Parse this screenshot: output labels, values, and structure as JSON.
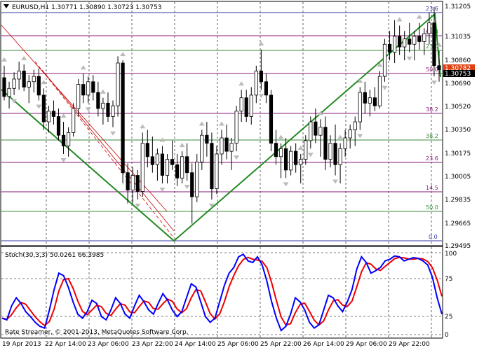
{
  "window": {
    "title": "EURUSD,H1  1.30771 1.30890 1.30723 1.30753",
    "menu_icon": "chart-menu-triangle-icon"
  },
  "indicator": {
    "title": "Stoch(30,3,3) 50.0261 66.3985",
    "levels": [
      "100",
      "75",
      "25",
      "0"
    ]
  },
  "copyright": "Rate Streamer, © 2001-2013, MetaQuotes Software Corp.",
  "colors": {
    "bull": "#000000",
    "bear": "#000000",
    "grid": "#000000",
    "fibo_blue": "#3a3aa8",
    "fibo_purple": "#8a1a7a",
    "fibo_green": "#3b8a3b",
    "trend_green": "#228b22",
    "channel_red": "#cc0000",
    "stoch_main": "#0000ff",
    "stoch_signal": "#ee0000",
    "price_tag_bg": "#e04010",
    "price_tag2_bg": "#000000"
  },
  "price_axis": [
    "1.31205",
    "1.31035",
    "1.30860",
    "1.30690",
    "1.30520",
    "1.30350",
    "1.30175",
    "1.30005",
    "1.29835",
    "1.29665",
    "1.29495"
  ],
  "price_tags": {
    "bid": "1.30753",
    "ask": "1.30782"
  },
  "fibo_labels": [
    "23.6",
    "61.8",
    "23.6",
    "50.0",
    "38.2",
    "38.2",
    "23.6",
    "14.5",
    "50.0",
    "0.0"
  ],
  "time_axis": [
    "19 Apr 2013",
    "22 Apr 14:00",
    "23 Apr 06:00",
    "23 Apr 22:00",
    "24 Apr 14:00",
    "25 Apr 06:00",
    "25 Apr 22:00",
    "26 Apr 14:00",
    "29 Apr 06:00",
    "29 Apr 22:00"
  ],
  "chart_data": {
    "type": "candlestick",
    "symbol": "EURUSD",
    "timeframe": "H1",
    "ylim": [
      1.2945,
      1.3125
    ],
    "candles": [
      [
        1.3069,
        1.3078,
        1.3052,
        1.3055
      ],
      [
        1.3055,
        1.3066,
        1.3046,
        1.3061
      ],
      [
        1.3061,
        1.3073,
        1.3056,
        1.3068
      ],
      [
        1.3068,
        1.3081,
        1.306,
        1.3074
      ],
      [
        1.3074,
        1.3079,
        1.3059,
        1.3062
      ],
      [
        1.3062,
        1.3071,
        1.305,
        1.3066
      ],
      [
        1.3066,
        1.3075,
        1.3058,
        1.307
      ],
      [
        1.307,
        1.3076,
        1.3052,
        1.3056
      ],
      [
        1.3056,
        1.3061,
        1.303,
        1.3036
      ],
      [
        1.3036,
        1.3048,
        1.3028,
        1.3044
      ],
      [
        1.3044,
        1.3052,
        1.3034,
        1.304
      ],
      [
        1.304,
        1.3046,
        1.3022,
        1.3026
      ],
      [
        1.3026,
        1.3036,
        1.3012,
        1.3018
      ],
      [
        1.3018,
        1.3032,
        1.301,
        1.3028
      ],
      [
        1.3028,
        1.305,
        1.3025,
        1.3046
      ],
      [
        1.3046,
        1.3068,
        1.304,
        1.3064
      ],
      [
        1.3064,
        1.3072,
        1.305,
        1.3056
      ],
      [
        1.3056,
        1.307,
        1.305,
        1.3066
      ],
      [
        1.3066,
        1.3071,
        1.3052,
        1.3058
      ],
      [
        1.3058,
        1.3066,
        1.304,
        1.3046
      ],
      [
        1.3046,
        1.3054,
        1.3034,
        1.305
      ],
      [
        1.305,
        1.3058,
        1.3036,
        1.304
      ],
      [
        1.304,
        1.3052,
        1.3032,
        1.3048
      ],
      [
        1.3048,
        1.3085,
        1.304,
        1.308
      ],
      [
        1.308,
        1.3082,
        1.299,
        1.2998
      ],
      [
        1.2998,
        1.3005,
        1.2975,
        1.2985
      ],
      [
        1.2985,
        1.3002,
        1.2975,
        1.2996
      ],
      [
        1.2996,
        1.3,
        1.2978,
        1.2984
      ],
      [
        1.2984,
        1.3028,
        1.298,
        1.302
      ],
      [
        1.302,
        1.303,
        1.3002,
        1.301
      ],
      [
        1.301,
        1.3025,
        1.2998,
        1.3004
      ],
      [
        1.3004,
        1.3016,
        1.2992,
        1.3012
      ],
      [
        1.3012,
        1.3018,
        1.299,
        1.2996
      ],
      [
        1.2996,
        1.3012,
        1.299,
        1.3008
      ],
      [
        1.3008,
        1.3022,
        1.3,
        1.3004
      ],
      [
        1.3004,
        1.3012,
        1.2988,
        1.2994
      ],
      [
        1.2994,
        1.3014,
        1.299,
        1.301
      ],
      [
        1.301,
        1.302,
        1.2992,
        1.2998
      ],
      [
        1.2998,
        1.3005,
        1.296,
        1.298
      ],
      [
        1.298,
        1.3012,
        1.2976,
        1.3006
      ],
      [
        1.3006,
        1.303,
        1.3,
        1.3026
      ],
      [
        1.3026,
        1.3036,
        1.301,
        1.302
      ],
      [
        1.302,
        1.3028,
        1.2978,
        1.2986
      ],
      [
        1.2986,
        1.3018,
        1.2982,
        1.3012
      ],
      [
        1.3012,
        1.303,
        1.3004,
        1.3024
      ],
      [
        1.3024,
        1.3034,
        1.3008,
        1.3014
      ],
      [
        1.3014,
        1.3024,
        1.3,
        1.302
      ],
      [
        1.302,
        1.3048,
        1.3014,
        1.3044
      ],
      [
        1.3044,
        1.306,
        1.3036,
        1.3054
      ],
      [
        1.3054,
        1.306,
        1.3036,
        1.304
      ],
      [
        1.304,
        1.3062,
        1.3034,
        1.3056
      ],
      [
        1.3056,
        1.3078,
        1.305,
        1.3074
      ],
      [
        1.3074,
        1.309,
        1.306,
        1.3066
      ],
      [
        1.3066,
        1.3072,
        1.305,
        1.3056
      ],
      [
        1.3056,
        1.306,
        1.3014,
        1.302
      ],
      [
        1.302,
        1.303,
        1.3004,
        1.301
      ],
      [
        1.301,
        1.302,
        1.2994,
        1.3016
      ],
      [
        1.3016,
        1.3024,
        1.2994,
        1.3
      ],
      [
        1.3,
        1.3018,
        1.2996,
        1.3014
      ],
      [
        1.3014,
        1.302,
        1.2998,
        1.3004
      ],
      [
        1.3004,
        1.3012,
        1.299,
        1.3008
      ],
      [
        1.3008,
        1.3026,
        1.3004,
        1.3022
      ],
      [
        1.3022,
        1.304,
        1.3016,
        1.3036
      ],
      [
        1.3036,
        1.3046,
        1.302,
        1.3026
      ],
      [
        1.3026,
        1.3038,
        1.301,
        1.3032
      ],
      [
        1.3032,
        1.304,
        1.3,
        1.3008
      ],
      [
        1.3008,
        1.3026,
        1.3002,
        1.302
      ],
      [
        1.302,
        1.3034,
        1.2996,
        1.3004
      ],
      [
        1.3004,
        1.302,
        1.299,
        1.3016
      ],
      [
        1.3016,
        1.303,
        1.301,
        1.3024
      ],
      [
        1.3024,
        1.3034,
        1.3016,
        1.303
      ],
      [
        1.303,
        1.304,
        1.3018,
        1.3036
      ],
      [
        1.3036,
        1.3062,
        1.303,
        1.3058
      ],
      [
        1.3058,
        1.3066,
        1.3042,
        1.305
      ],
      [
        1.305,
        1.306,
        1.304,
        1.3054
      ],
      [
        1.3054,
        1.3062,
        1.3044,
        1.3048
      ],
      [
        1.3048,
        1.3074,
        1.3046,
        1.307
      ],
      [
        1.307,
        1.3098,
        1.3066,
        1.3094
      ],
      [
        1.3094,
        1.3104,
        1.3082,
        1.3088
      ],
      [
        1.3088,
        1.3112,
        1.308,
        1.31
      ],
      [
        1.31,
        1.3108,
        1.3086,
        1.3092
      ],
      [
        1.3092,
        1.3104,
        1.3082,
        1.3098
      ],
      [
        1.3098,
        1.311,
        1.3088,
        1.3094
      ],
      [
        1.3094,
        1.3104,
        1.3082,
        1.31
      ],
      [
        1.31,
        1.311,
        1.309,
        1.3096
      ],
      [
        1.3096,
        1.3106,
        1.3086,
        1.3102
      ],
      [
        1.3102,
        1.3118,
        1.3094,
        1.311
      ],
      [
        1.311,
        1.3122,
        1.307,
        1.3078
      ],
      [
        1.3078,
        1.3089,
        1.3066,
        1.3075
      ]
    ]
  }
}
